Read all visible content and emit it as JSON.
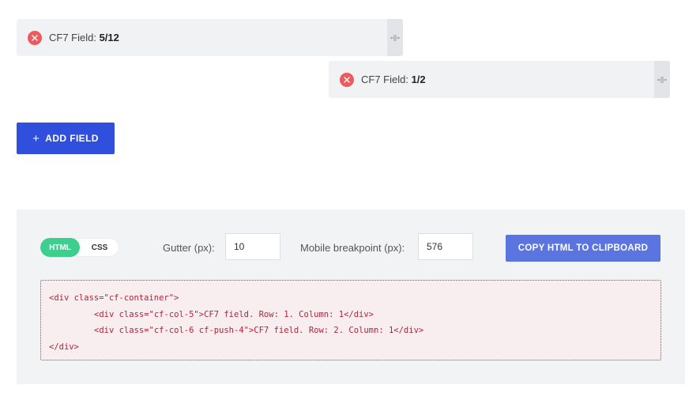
{
  "fields": [
    {
      "prefix": "CF7 Field: ",
      "value": "5/12"
    },
    {
      "prefix": "CF7 Field: ",
      "value": "1/2"
    }
  ],
  "icons": {
    "remove": "close-circle-icon",
    "resize": "resize-handle-icon",
    "add": "plus-icon"
  },
  "add_button": {
    "plus": "+",
    "label": "ADD FIELD"
  },
  "panel": {
    "tabs": [
      {
        "label": "HTML",
        "active": true
      },
      {
        "label": "CSS",
        "active": false
      }
    ],
    "gutter": {
      "label": "Gutter (px):",
      "value": "10"
    },
    "breakpoint": {
      "label": "Mobile breakpoint (px):",
      "value": "576"
    },
    "copy_label": "COPY HTML TO CLIPBOARD",
    "code_lines": [
      "<div class=\"cf-container\">",
      "<div class=\"cf-col-5\">CF7 field. Row: 1. Column: 1</div>",
      "<div class=\"cf-col-6 cf-push-4\">CF7 field. Row: 2. Column: 1</div>",
      "</div>"
    ]
  },
  "colors": {
    "accent": "#2f4fdc",
    "toggle_active": "#3ecf8e",
    "remove": "#ea5b5f",
    "code_text": "#b3233a"
  }
}
